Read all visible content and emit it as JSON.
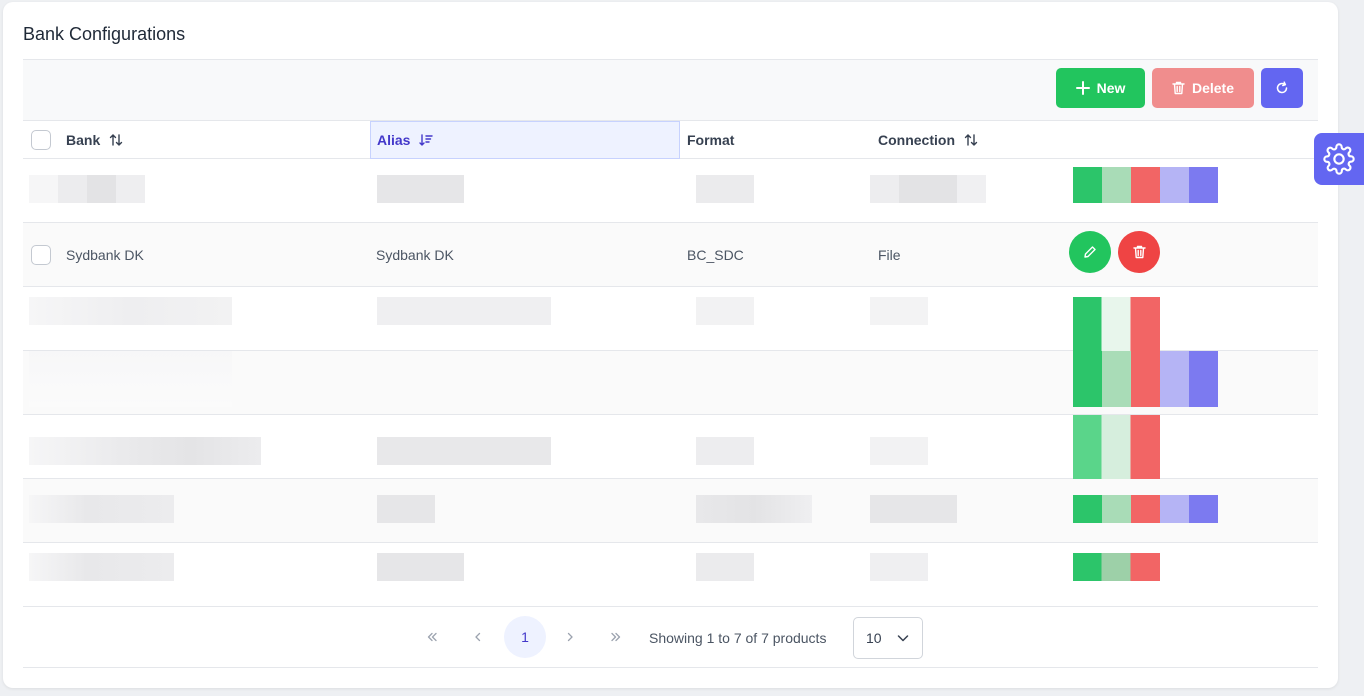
{
  "page": {
    "title": "Bank Configurations"
  },
  "toolbar": {
    "new_label": "New",
    "delete_label": "Delete"
  },
  "table": {
    "columns": {
      "bank": "Bank",
      "alias": "Alias",
      "format": "Format",
      "connection": "Connection"
    },
    "visible_row": {
      "bank": "Sydbank DK",
      "alias": "Sydbank DK",
      "format": "BC_SDC",
      "connection": "File"
    }
  },
  "pagination": {
    "current_page": "1",
    "showing": "Showing 1 to 7 of 7 products",
    "page_size": "10"
  },
  "colors": {
    "accent": "#6366f1",
    "success": "#22c55e",
    "danger": "#ef4444",
    "danger_light": "#f08d8d",
    "sorted_bg": "#eef2ff"
  },
  "icons": {
    "new": "plus-icon",
    "delete": "trash-icon",
    "refresh": "refresh-icon",
    "sort": "sort-icon",
    "edit": "pencil-icon",
    "settings": "gear-icon"
  }
}
